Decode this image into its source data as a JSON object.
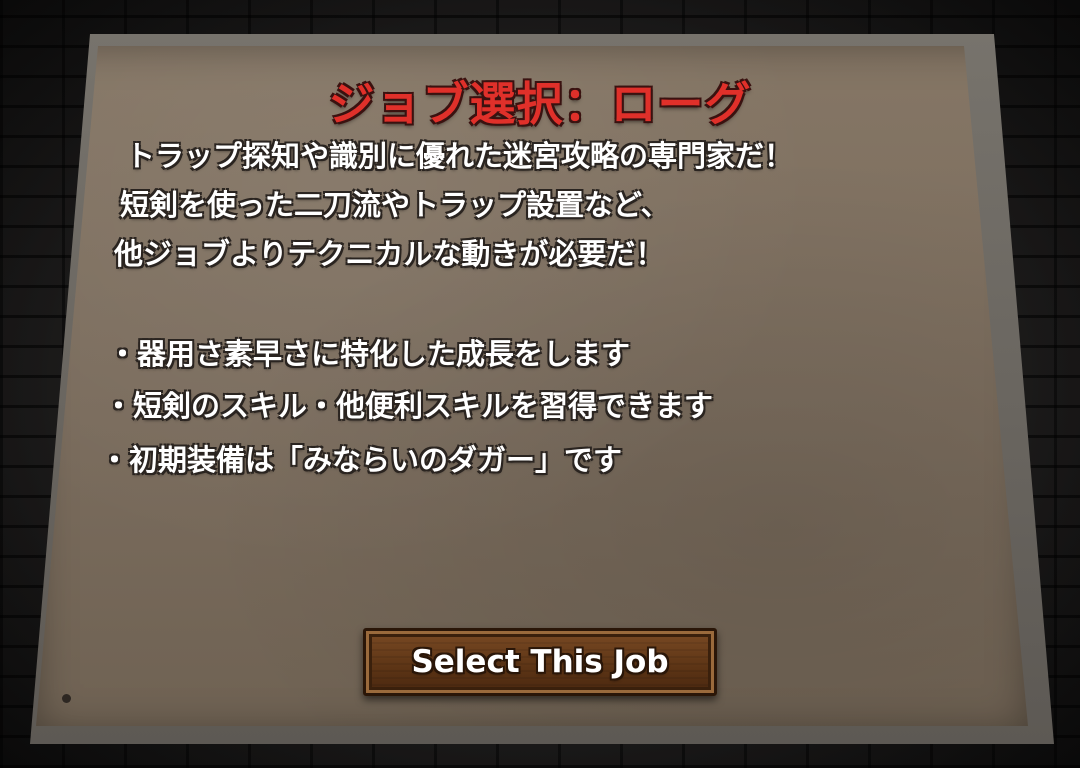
{
  "job_panel": {
    "title": "ジョブ選択：ローグ",
    "description_lines": [
      "トラップ探知や識別に優れた迷宮攻略の専門家だ！",
      "短剣を使った二刀流やトラップ設置など、",
      "他ジョブよりテクニカルな動きが必要だ！"
    ],
    "bullets": [
      "・器用さ素早さに特化した成長をします",
      "・短剣のスキル・他便利スキルを習得できます",
      "・初期装備は「みならいのダガー」です"
    ],
    "select_button_label": "Select This Job"
  },
  "colors": {
    "title": "#e0302a",
    "text": "#ffffff",
    "board": "#7d6f60",
    "frame": "#6a6661",
    "button": "#5c3415",
    "background": "#1b1a1a"
  }
}
